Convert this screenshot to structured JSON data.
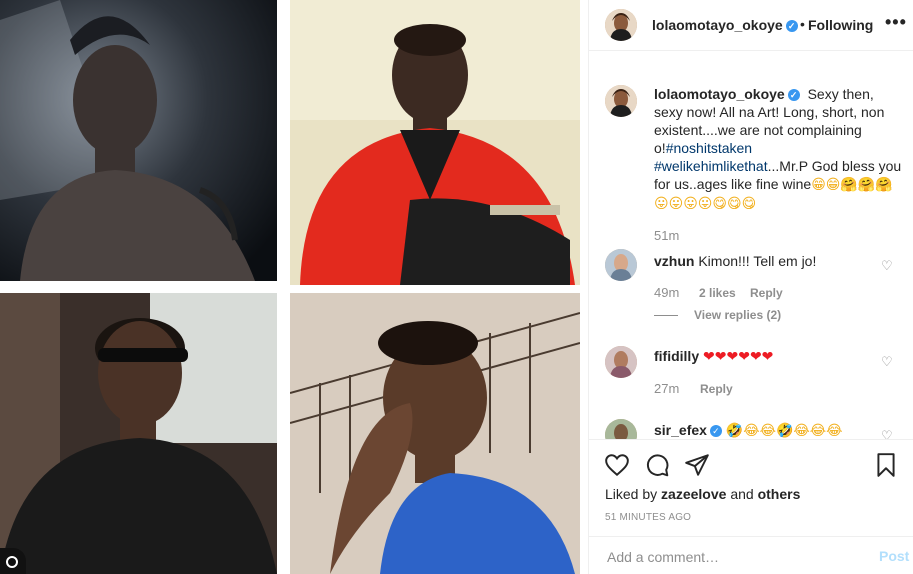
{
  "header": {
    "username": "lolaomotayo_okoye",
    "verified_icon": "verified-badge-icon",
    "separator": "•",
    "follow_status": "Following",
    "more_label": "•••"
  },
  "caption": {
    "username": "lolaomotayo_okoye",
    "text_1": "Sexy then, sexy now! All na Art! Long, short, non existent....we are not complaining o!",
    "hashtag_1": "#noshitstaken",
    "hashtag_2": "#welikehimlikethat",
    "text_2": "...Mr.P God bless you for us..ages like fine wine",
    "emojis": "😁😁🤗🤗🤗😛😛😛😛😋😋😋",
    "time": "51m"
  },
  "comments": [
    {
      "username": "vzhun",
      "text": "Kimon!!! Tell em jo!",
      "time": "49m",
      "likes": "2 likes",
      "reply": "Reply",
      "view_replies": "View replies (2)"
    },
    {
      "username": "fifidilly",
      "text": "❤❤❤❤❤❤",
      "time": "27m",
      "reply": "Reply"
    },
    {
      "username": "sir_efex",
      "text": "🤣😂😂🤣😂😂😂"
    }
  ],
  "actions": {
    "like_icon": "heart-icon",
    "comment_icon": "comment-icon",
    "share_icon": "share-icon",
    "save_icon": "bookmark-icon"
  },
  "likes": {
    "prefix": "Liked by",
    "user": "zazeelove",
    "and": "and",
    "others": "others"
  },
  "timestamp": "51 MINUTES AGO",
  "add_comment": {
    "placeholder": "Add a comment…",
    "post_label": "Post"
  },
  "colors": {
    "verified": "#3897f0",
    "link": "#00376b",
    "muted": "#8e8e8e",
    "post_disabled": "#b2dffc",
    "jacket_red": "#e32a1e",
    "shirt_blue": "#2d63c8"
  }
}
